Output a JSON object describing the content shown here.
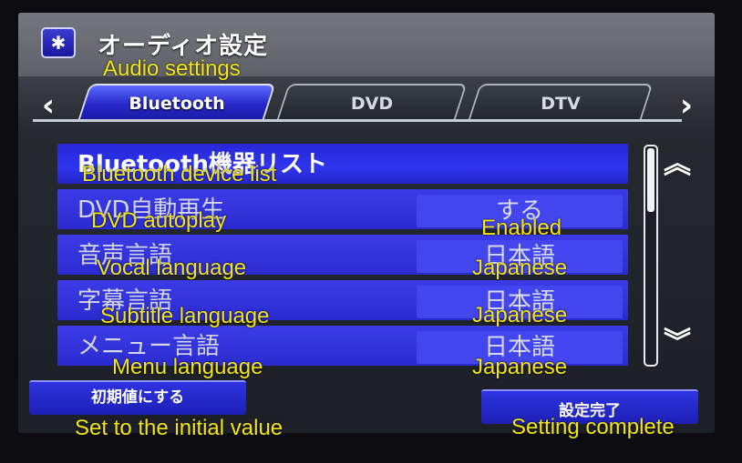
{
  "header": {
    "title": "オーディオ設定",
    "icon": "gear-icon"
  },
  "tabs": [
    {
      "label": "Bluetooth",
      "active": true
    },
    {
      "label": "DVD",
      "active": false
    },
    {
      "label": "DTV",
      "active": false
    }
  ],
  "nav": {
    "prev": "‹",
    "next": "›"
  },
  "list": [
    {
      "label": "Bluetooth機器リスト",
      "value": ""
    },
    {
      "label": "DVD自動再生",
      "value": "する"
    },
    {
      "label": "音声言語",
      "value": "日本語"
    },
    {
      "label": "字幕言語",
      "value": "日本語"
    },
    {
      "label": "メニュー言語",
      "value": "日本語"
    }
  ],
  "scroll": {
    "up": "︽",
    "down": "︾"
  },
  "buttons": {
    "reset": "初期値にする",
    "done": "設定完了"
  },
  "annotations": {
    "title": "Audio settings",
    "row0": "Bluetooth device list",
    "row1": "DVD autoplay",
    "row1_value": "Enabled",
    "row2": "Vocal language",
    "row2_value": "Japanese",
    "row3": "Subtitle language",
    "row3_value": "Japanese",
    "row4": "Menu language",
    "row4_value": "Japanese",
    "reset": "Set to the initial value",
    "done": "Setting complete"
  },
  "colors": {
    "annotation": "#f4e51a",
    "row": "#3b3ce6",
    "active_tab": "#2727c8"
  }
}
